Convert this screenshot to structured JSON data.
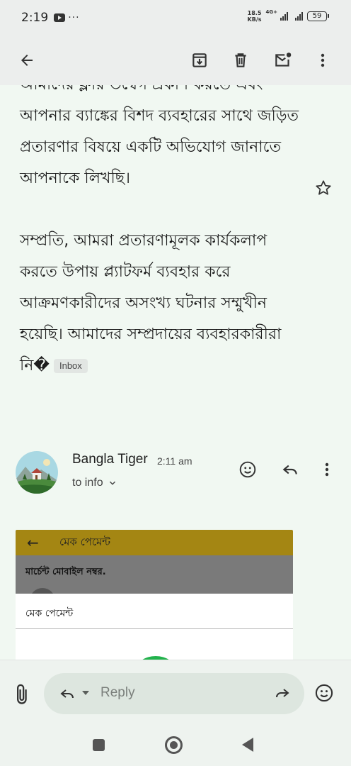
{
  "status_bar": {
    "time": "2:19",
    "overflow_dots": "···",
    "net_speed_value": "18.5",
    "net_speed_unit": "KB/s",
    "network_type": "4G+",
    "battery": "59"
  },
  "email": {
    "paragraphs": [
      "আমাদের ফ্লার উদ্বেগ প্রকাশ করতে এবং আপনার ব্যাঙ্কের বিশদ ব্যবহারের সাথে জড়িত প্রতারণার বিষয়ে একটি অভিযোগ জানাতে আপনাকে লিখছি।",
      "সম্প্রতি, আমরা প্রতারণামূলক কার্যকলাপ করতে উপায় প্ল্যাটফর্ম ব্যবহার করে আক্রমণকারীদের অসংখ্য ঘটনার সম্মুখীন হয়েছি। আমাদের সম্প্রদায়ের ব্যবহারকারীরা নি�"
    ],
    "inbox_label": "Inbox"
  },
  "sender": {
    "name": "Bangla Tiger",
    "time": "2:11 am",
    "to": "to info"
  },
  "attachment": {
    "header_title": "মেক পেমেন্ট",
    "merchant_label": "মার্চেন্ট মোবাইল নম্বর.",
    "panel_title": "মেক পেমেন্ট",
    "header_color": "#a48613",
    "button_color": "#22b24c"
  },
  "reply": {
    "placeholder": "Reply"
  },
  "icons": {
    "toolbar": [
      "back-arrow-icon",
      "archive-icon",
      "delete-icon",
      "mark-unread-icon",
      "more-vert-icon"
    ],
    "message": [
      "star-icon",
      "emoji-icon",
      "reply-icon",
      "more-vert-icon"
    ],
    "compose": [
      "attach-icon",
      "reply-arrow-icon",
      "forward-icon",
      "emoji-icon"
    ],
    "nav": [
      "recents-icon",
      "home-icon",
      "back-icon"
    ]
  }
}
